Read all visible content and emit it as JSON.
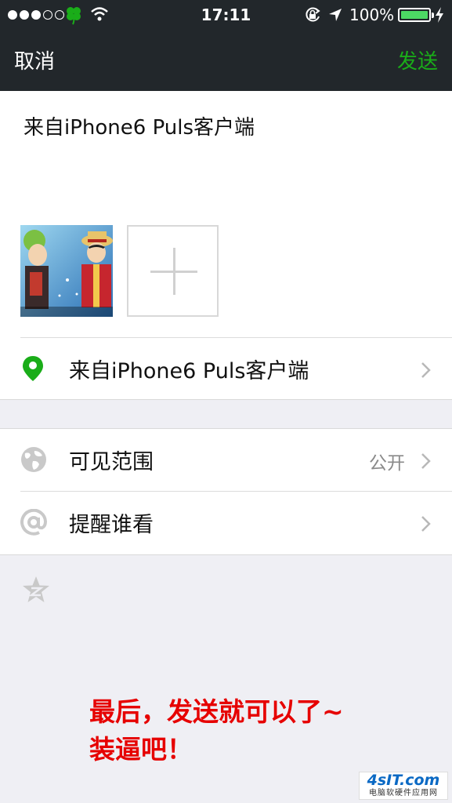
{
  "status_bar": {
    "time": "17:11",
    "battery_percent": "100%",
    "signal_filled": 3,
    "signal_total": 5
  },
  "nav": {
    "cancel": "取消",
    "send": "发送"
  },
  "compose": {
    "text": "来自iPhone6 Puls客户端"
  },
  "location": {
    "label": "来自iPhone6 Puls客户端"
  },
  "visibility": {
    "label": "可见范围",
    "value": "公开"
  },
  "mention": {
    "label": "提醒谁看"
  },
  "caption": {
    "line1": "最后，发送就可以了~",
    "line2": "装逼吧！"
  },
  "watermark": {
    "logo": "4sIT.com",
    "text": "电脑软硬件应用网"
  },
  "colors": {
    "nav_bg": "#22272b",
    "send": "#1aad19",
    "pin": "#1aad19",
    "caption": "#e60000",
    "battery": "#4cd964"
  }
}
